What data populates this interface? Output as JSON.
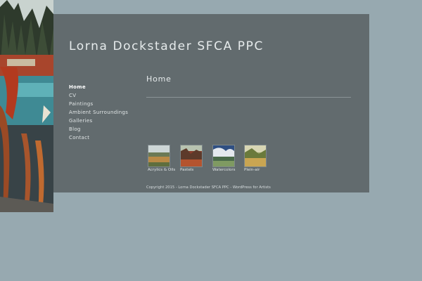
{
  "site": {
    "title": "Lorna Dockstader SFCA PPC"
  },
  "nav": {
    "items": [
      {
        "label": "Home",
        "active": true
      },
      {
        "label": "CV"
      },
      {
        "label": "Paintings"
      },
      {
        "label": "Ambient Surroundings"
      },
      {
        "label": "Galleries"
      },
      {
        "label": "Blog"
      },
      {
        "label": "Contact"
      }
    ]
  },
  "main": {
    "heading": "Home",
    "galleries": [
      {
        "caption": "Acrylics & Oils"
      },
      {
        "caption": "Pastels"
      },
      {
        "caption": "Watercolors"
      },
      {
        "caption": "Plein-air"
      }
    ]
  },
  "footer": {
    "copyright": "Copyright 2015 - Lorna Dockstader SFCA PPC - WordPress for Artists"
  },
  "colors": {
    "page_bg": "#97a9b0",
    "panel_bg": "#626b6e",
    "text": "#e6ebec"
  }
}
